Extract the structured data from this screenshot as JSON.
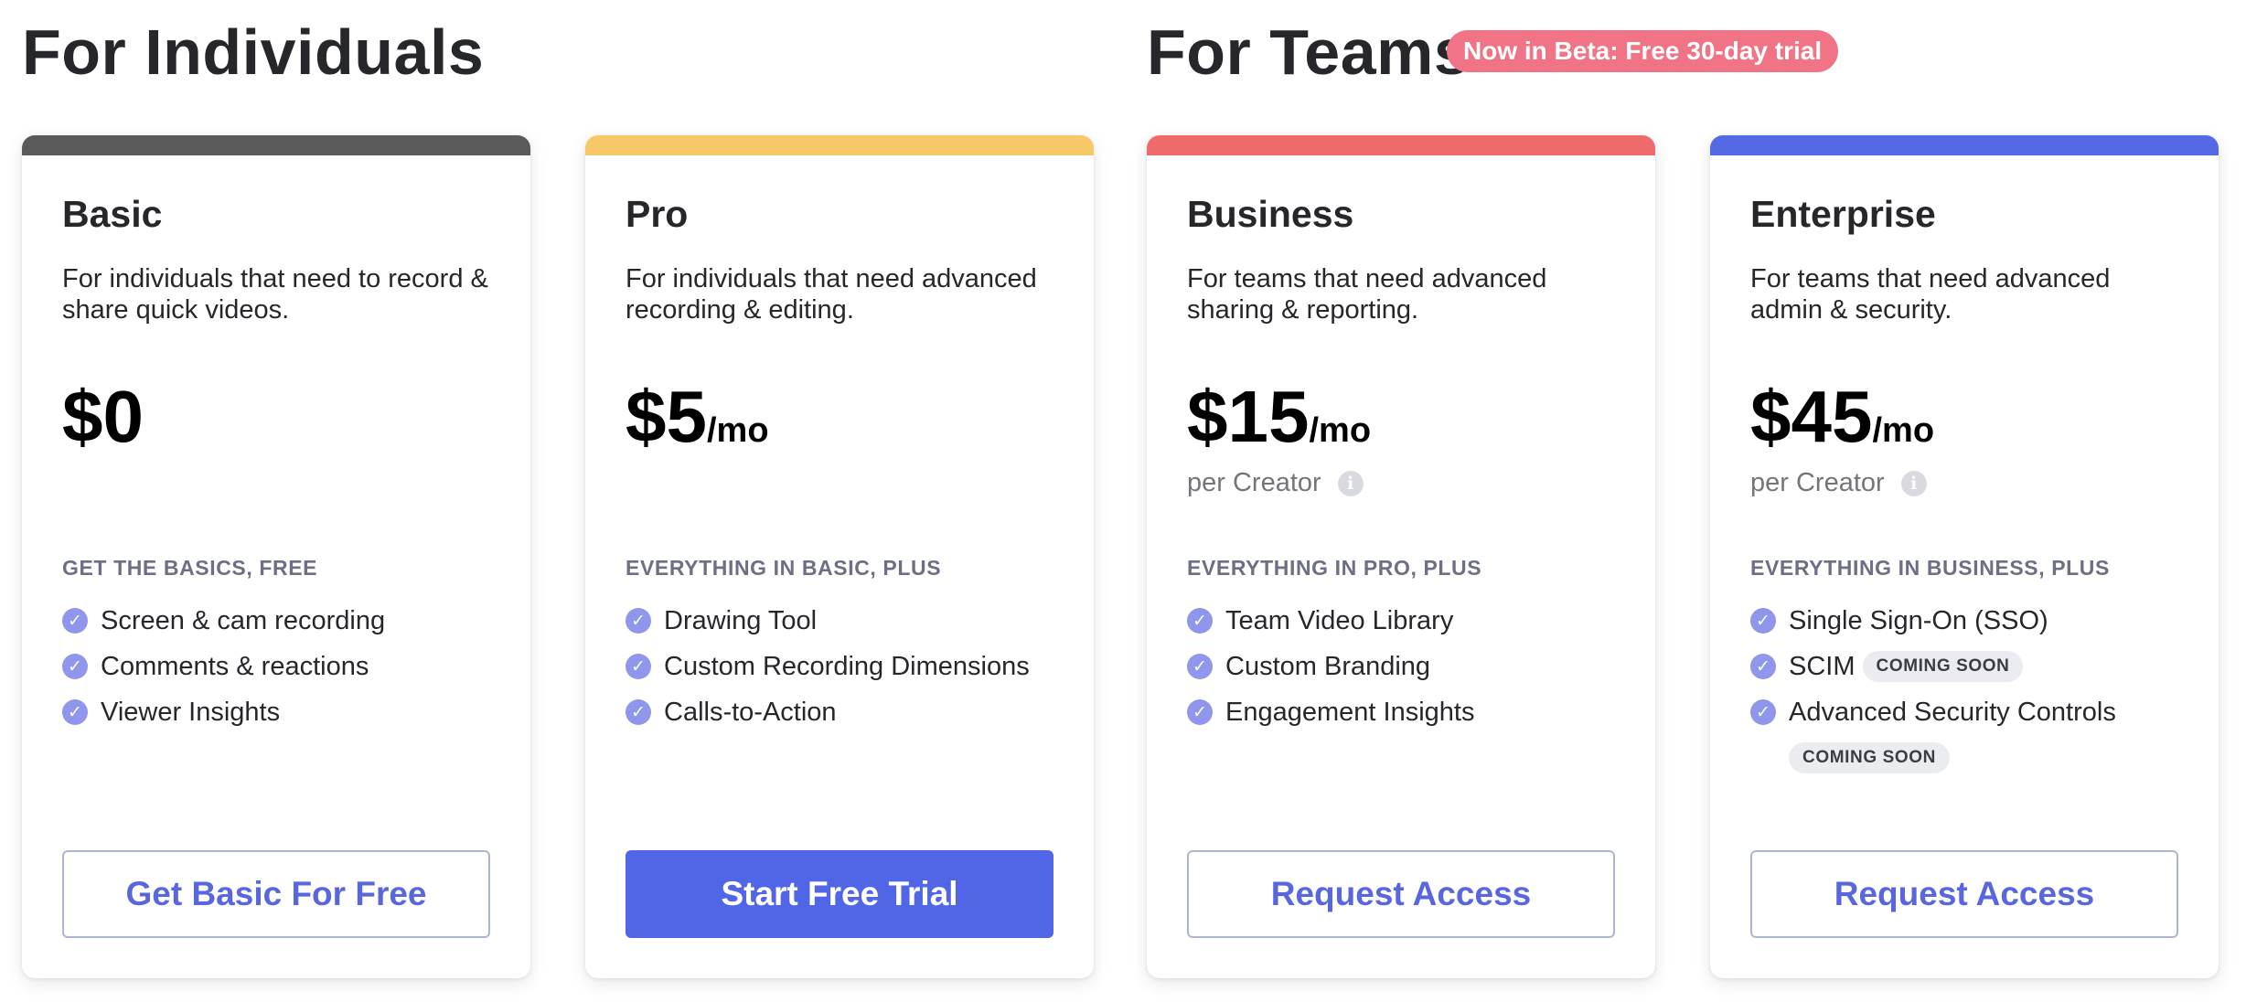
{
  "sections": {
    "individuals_title": "For Individuals",
    "teams_title": "For Teams",
    "teams_badge": "Now in Beta: Free 30-day trial"
  },
  "colors": {
    "basic_strip": "#5a5a5a",
    "pro_strip": "#f6c867",
    "business_strip": "#ef6a6b",
    "enterprise_strip": "#5568e6",
    "badge_bg": "#f07485",
    "check_icon": "#8f96ec",
    "primary_button": "#5066e7"
  },
  "plans": [
    {
      "name": "Basic",
      "description": "For individuals that need to record & share quick videos.",
      "price": "$0",
      "period": "",
      "price_note": "",
      "features_heading": "GET THE BASICS, FREE",
      "features": [
        "Screen & cam recording",
        "Comments & reactions",
        "Viewer Insights"
      ],
      "cta": "Get Basic For Free"
    },
    {
      "name": "Pro",
      "description": "For individuals that need advanced recording & editing.",
      "price": "$5",
      "period": "/mo",
      "price_note": "",
      "features_heading": "EVERYTHING IN BASIC, PLUS",
      "features": [
        "Drawing Tool",
        "Custom Recording Dimensions",
        "Calls-to-Action"
      ],
      "cta": "Start Free Trial"
    },
    {
      "name": "Business",
      "description": "For teams that need advanced sharing & reporting.",
      "price": "$15",
      "period": "/mo",
      "price_note": "per Creator",
      "features_heading": "EVERYTHING IN PRO, PLUS",
      "features": [
        "Team Video Library",
        "Custom Branding",
        "Engagement Insights"
      ],
      "cta": "Request Access"
    },
    {
      "name": "Enterprise",
      "description": "For teams that need advanced admin & security.",
      "price": "$45",
      "period": "/mo",
      "price_note": "per Creator",
      "features_heading": "EVERYTHING IN BUSINESS, PLUS",
      "features": [
        "Single Sign-On (SSO)",
        "SCIM",
        "Advanced Security Controls"
      ],
      "feature_badges": [
        "",
        "COMING SOON",
        "COMING SOON"
      ],
      "cta": "Request Access"
    }
  ]
}
